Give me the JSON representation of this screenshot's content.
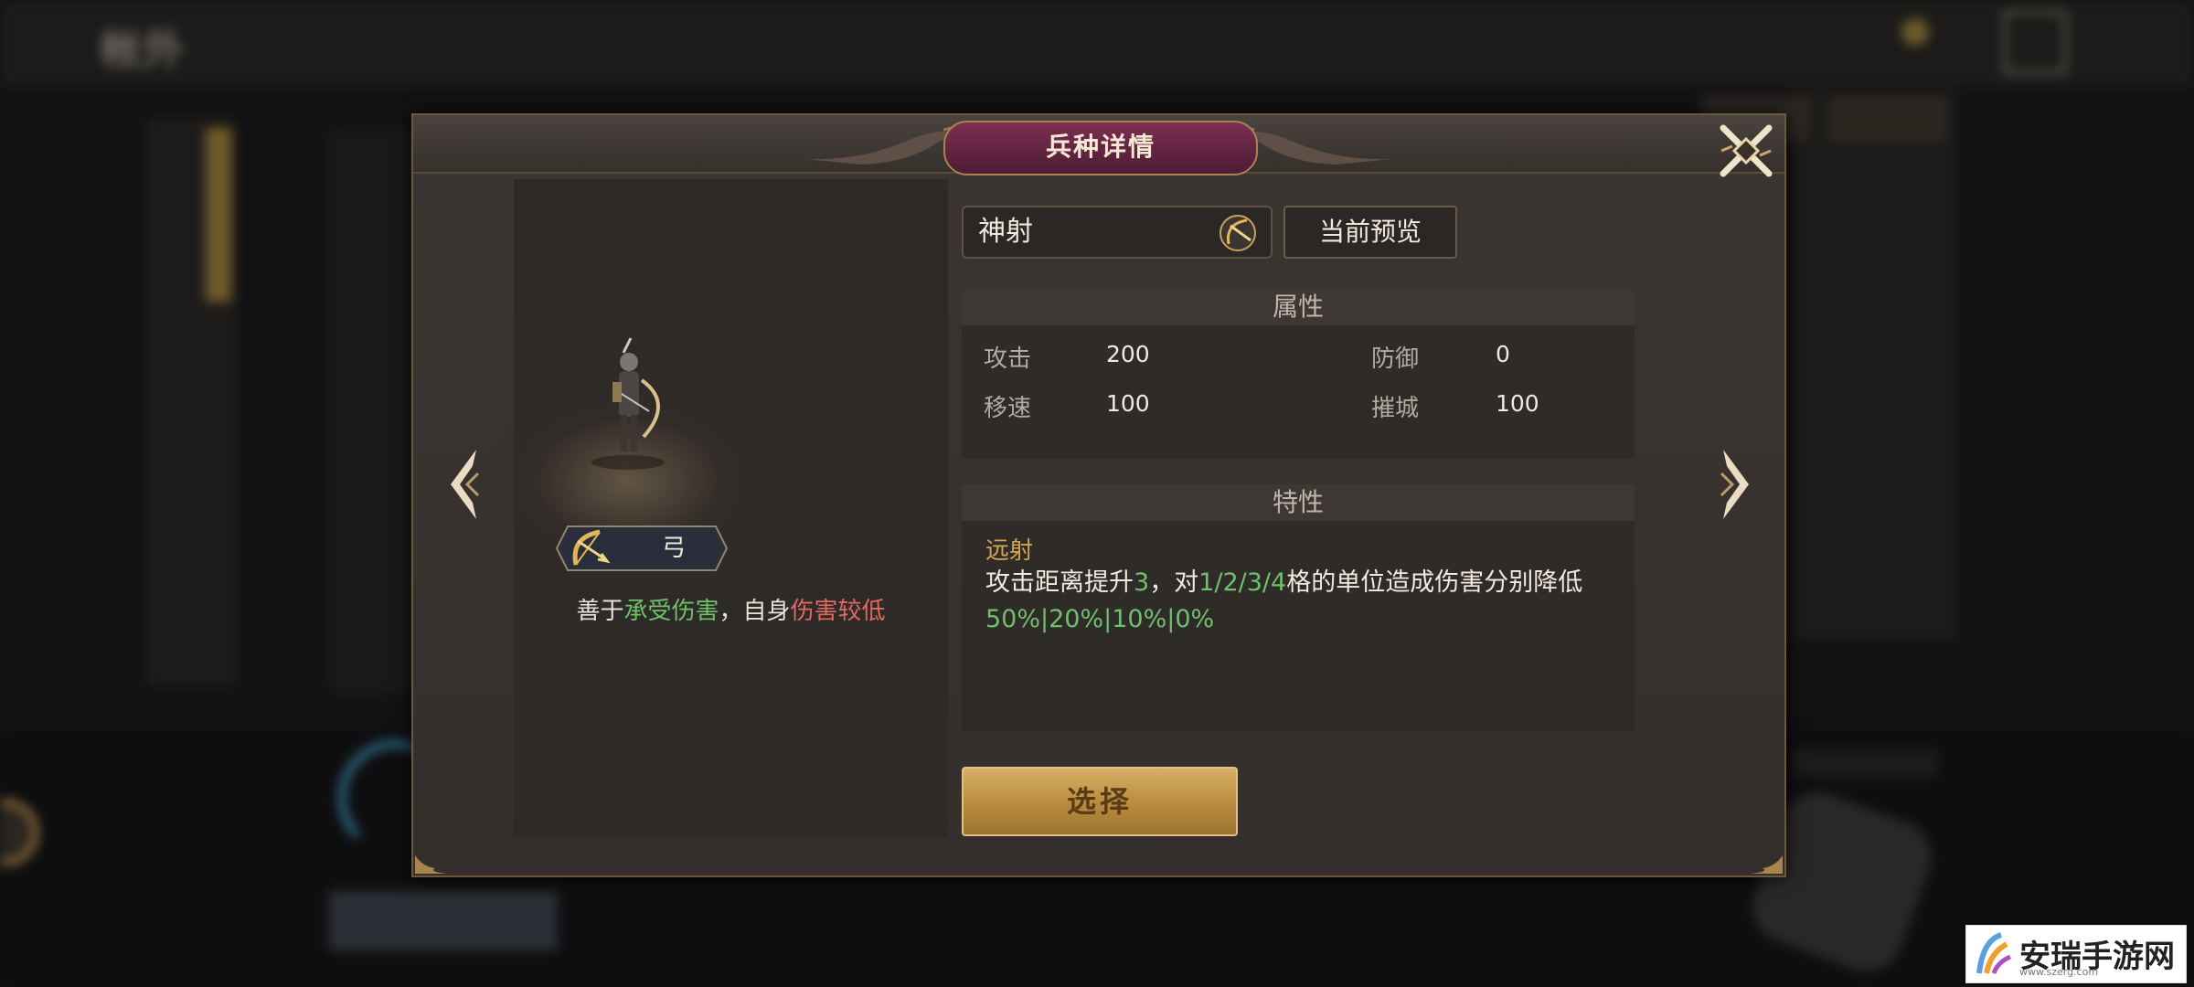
{
  "background": {
    "title": "帐外"
  },
  "modal": {
    "title": "兵种详情",
    "unit": {
      "type_label": "弓",
      "desc_prefix": "善于",
      "desc_good": "承受伤害",
      "desc_mid": "，自身",
      "desc_bad": "伤害较低"
    },
    "name": "神射",
    "preview_button": "当前预览",
    "attributes": {
      "heading": "属性",
      "items": [
        {
          "label": "攻击",
          "value": "200"
        },
        {
          "label": "防御",
          "value": "0"
        },
        {
          "label": "移速",
          "value": "100"
        },
        {
          "label": "摧城",
          "value": "100"
        }
      ]
    },
    "traits": {
      "heading": "特性",
      "name": "远射",
      "desc_1": "攻击距离提升",
      "desc_num": "3",
      "desc_2": "，对",
      "desc_grids": "1/2/3/4",
      "desc_3": "格的单位造成伤害分别降低",
      "desc_values": "50%|20%|10%|0%"
    },
    "select_button": "选择"
  },
  "watermark": {
    "text": "安瑞手游网",
    "url": "www.szerg.com"
  },
  "colors": {
    "accent_gold": "#d7a64c",
    "good_green": "#6fc06a",
    "bad_red": "#e06a60",
    "title_plate": "#7c2f50"
  },
  "icons": [
    "close-icon",
    "arrow-left-icon",
    "arrow-right-icon",
    "bow-icon"
  ]
}
